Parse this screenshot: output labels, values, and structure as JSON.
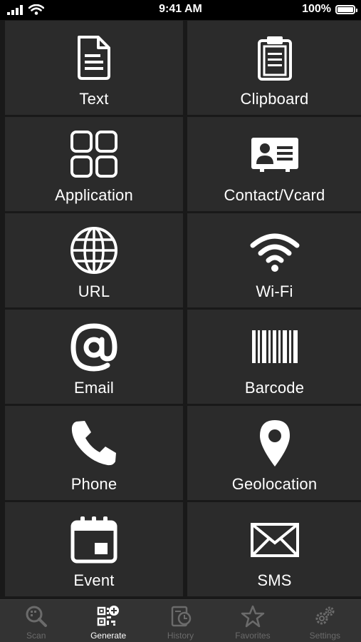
{
  "status_bar": {
    "time": "9:41 AM",
    "battery": "100%"
  },
  "tiles": [
    {
      "label": "Text",
      "icon": "document-icon"
    },
    {
      "label": "Clipboard",
      "icon": "clipboard-icon"
    },
    {
      "label": "Application",
      "icon": "apps-grid-icon"
    },
    {
      "label": "Contact/Vcard",
      "icon": "contact-card-icon"
    },
    {
      "label": "URL",
      "icon": "globe-icon"
    },
    {
      "label": "Wi-Fi",
      "icon": "wifi-icon"
    },
    {
      "label": "Email",
      "icon": "at-sign-icon"
    },
    {
      "label": "Barcode",
      "icon": "barcode-icon"
    },
    {
      "label": "Phone",
      "icon": "phone-icon"
    },
    {
      "label": "Geolocation",
      "icon": "map-pin-icon"
    },
    {
      "label": "Event",
      "icon": "calendar-icon"
    },
    {
      "label": "SMS",
      "icon": "envelope-icon"
    }
  ],
  "tab_bar": {
    "active": "Generate",
    "tabs": [
      {
        "label": "Scan",
        "icon": "scan-icon"
      },
      {
        "label": "Generate",
        "icon": "qr-plus-icon"
      },
      {
        "label": "History",
        "icon": "history-icon"
      },
      {
        "label": "Favorites",
        "icon": "star-icon"
      },
      {
        "label": "Settings",
        "icon": "gears-icon"
      }
    ]
  },
  "colors": {
    "background": "#191919",
    "tile": "#2b2b2b",
    "tab_bar": "#333333",
    "inactive": "#6b6b6b",
    "active": "#ffffff"
  }
}
